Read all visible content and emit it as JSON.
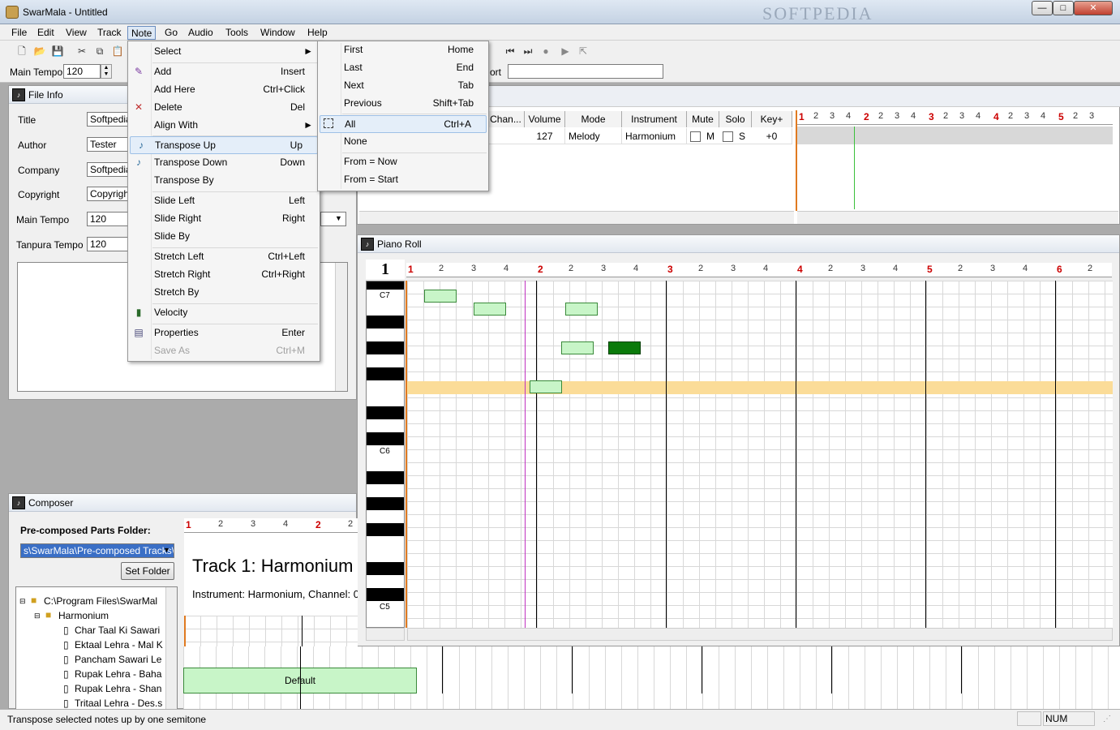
{
  "window": {
    "title": "SwarMala - Untitled",
    "watermark": "SOFTPEDIA",
    "min": "—",
    "max": "□",
    "close": "✕"
  },
  "menubar": [
    "File",
    "Edit",
    "View",
    "Track",
    "Note",
    "Go",
    "Audio",
    "Tools",
    "Window",
    "Help"
  ],
  "toolbar": {
    "main_tempo_label": "Main Tempo",
    "main_tempo_value": "120",
    "port_label": "ort"
  },
  "file_info": {
    "title": "File Info",
    "fields": [
      {
        "label": "Title",
        "value": "Softpedia"
      },
      {
        "label": "Author",
        "value": "Tester"
      },
      {
        "label": "Company",
        "value": "Softpedia"
      },
      {
        "label": "Copyright",
        "value": "Copyright"
      },
      {
        "label": "Main Tempo",
        "value": "120"
      },
      {
        "label": "Tanpura Tempo",
        "value": "120"
      }
    ]
  },
  "note_menu": [
    {
      "label": "Select",
      "key": "",
      "arrow": "►"
    },
    {
      "label": "Add",
      "key": "Insert"
    },
    {
      "label": "Add Here",
      "key": "Ctrl+Click"
    },
    {
      "label": "Delete",
      "key": "Del"
    },
    {
      "label": "Align With",
      "key": "",
      "arrow": "►"
    },
    {
      "label": "Transpose Up",
      "key": "Up"
    },
    {
      "label": "Transpose Down",
      "key": "Down"
    },
    {
      "label": "Transpose By",
      "key": ""
    },
    {
      "label": "Slide Left",
      "key": "Left"
    },
    {
      "label": "Slide Right",
      "key": "Right"
    },
    {
      "label": "Slide By",
      "key": ""
    },
    {
      "label": "Stretch Left",
      "key": "Ctrl+Left"
    },
    {
      "label": "Stretch Right",
      "key": "Ctrl+Right"
    },
    {
      "label": "Stretch By",
      "key": ""
    },
    {
      "label": "Velocity",
      "key": ""
    },
    {
      "label": "Properties",
      "key": "Enter"
    },
    {
      "label": "Save As",
      "key": "Ctrl+M"
    }
  ],
  "select_submenu": [
    {
      "label": "First",
      "key": "Home"
    },
    {
      "label": "Last",
      "key": "End"
    },
    {
      "label": "Next",
      "key": "Tab"
    },
    {
      "label": "Previous",
      "key": "Shift+Tab"
    },
    {
      "label": "All",
      "key": "Ctrl+A"
    },
    {
      "label": "None",
      "key": ""
    },
    {
      "label": "From = Now",
      "key": ""
    },
    {
      "label": "From = Start",
      "key": ""
    }
  ],
  "tracks": {
    "headers": [
      "Chan...",
      "Volume",
      "Mode",
      "Instrument",
      "Mute",
      "Solo",
      "Key+"
    ],
    "row": {
      "volume": "127",
      "mode": "Melody",
      "instrument": "Harmonium",
      "mute": "M",
      "solo": "S",
      "key": "+0"
    }
  },
  "piano_roll": {
    "title": "Piano Roll",
    "corner": "1",
    "keys": [
      "C7",
      "C6",
      "C5"
    ],
    "bars": [
      "1",
      "2",
      "3",
      "4",
      "5",
      "6"
    ],
    "beats": [
      "2",
      "3",
      "4"
    ]
  },
  "composer": {
    "title": "Composer",
    "folder_label": "Pre-composed Parts Folder:",
    "folder_value": "s\\SwarMala\\Pre-composed Tracks\\",
    "set_folder": "Set Folder",
    "tree": [
      "C:\\Program Files\\SwarMal",
      "Harmonium",
      "Char Taal Ki Sawari",
      "Ektaal Lehra - Mal K",
      "Pancham Sawari Le",
      "Rupak Lehra - Baha",
      "Rupak Lehra - Shan",
      "Tritaal Lehra - Des.s"
    ],
    "track_title": "Track 1: Harmonium",
    "track_info": "Instrument: Harmonium, Channel: 0",
    "clip_label": "Default"
  },
  "status": {
    "text": "Transpose selected notes up by one semitone",
    "num": "NUM"
  }
}
